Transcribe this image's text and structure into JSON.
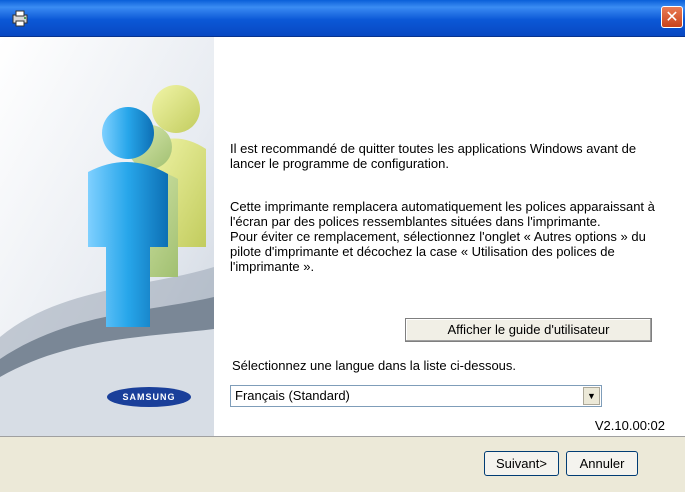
{
  "window": {
    "title": ""
  },
  "messages": {
    "recommend": "Il est recommandé de quitter toutes les applications Windows avant de lancer le programme de configuration.",
    "fonts_lines": [
      "Cette imprimante remplacera automatiquement les polices apparaissant à",
      "l'écran par des polices ressemblantes situées dans l'imprimante.",
      "Pour éviter ce remplacement, sélectionnez l'onglet « Autres options » du",
      "pilote d'imprimante et décochez la case « Utilisation des polices de",
      "l'imprimante »."
    ]
  },
  "guide_button": {
    "label": "Afficher le guide d'utilisateur"
  },
  "language": {
    "prompt": "Sélectionnez une langue dans la liste ci-dessous.",
    "selected": "Français (Standard)"
  },
  "logo": {
    "text": "SAMSUNG"
  },
  "version": "V2.10.00:02",
  "buttons": {
    "next": "Suivant>",
    "cancel": "Annuler"
  },
  "icons": {
    "app": "printer-setup-icon",
    "close": "close-icon",
    "dropdown": "chevron-down-icon"
  },
  "colors": {
    "titlebar": "#0b58d6",
    "close": "#d9542b",
    "logo": "#1a3f9a",
    "dialog_bg": "#ece9d8"
  }
}
